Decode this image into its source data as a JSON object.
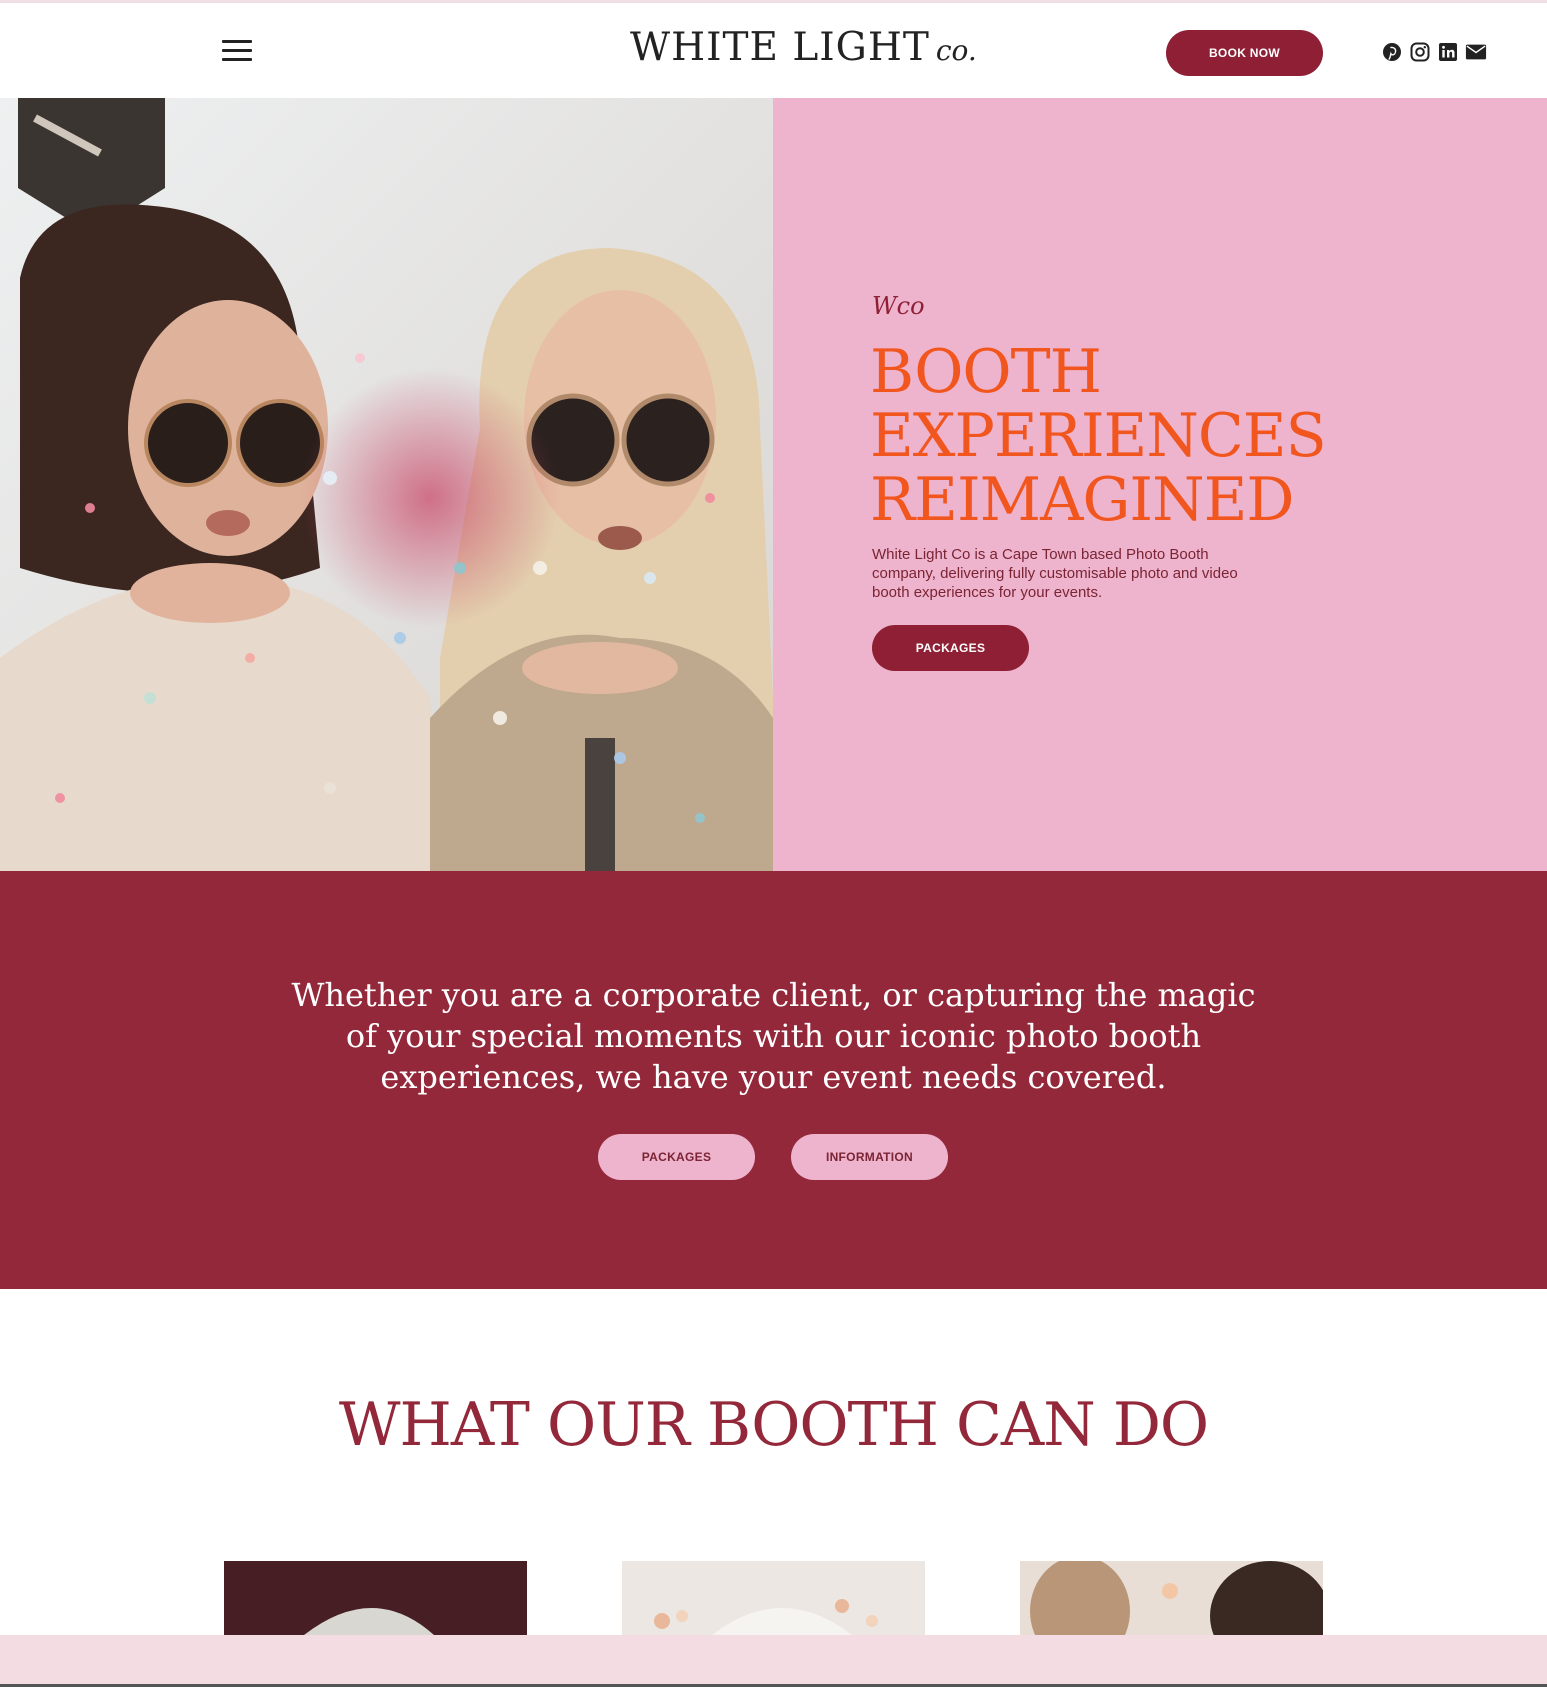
{
  "header": {
    "logo_main": "WHITE LIGHT",
    "logo_suffix": "co.",
    "book_label": "BOOK NOW",
    "social_icons": [
      "pinterest-icon",
      "instagram-icon",
      "linkedin-icon",
      "mail-icon"
    ]
  },
  "hero": {
    "monogram": "Wco",
    "title_line1": "BOOTH",
    "title_line2": "EXPERIENCES",
    "title_line3": "REIMAGINED",
    "description": "White Light Co is a Cape Town based Photo Booth company, delivering fully customisable photo and video booth experiences for your events.",
    "packages_label": "PACKAGES"
  },
  "band": {
    "text": "Whether you are a corporate client, or capturing the magic of your special moments with our iconic photo booth experiences, we have your event needs covered.",
    "packages_label": "PACKAGES",
    "information_label": "INFORMATION"
  },
  "features": {
    "title": "WHAT OUR BOOTH CAN DO"
  },
  "colors": {
    "burgundy": "#93283a",
    "pink": "#efb4cd",
    "orange": "#f2561f",
    "white": "#ffffff"
  }
}
